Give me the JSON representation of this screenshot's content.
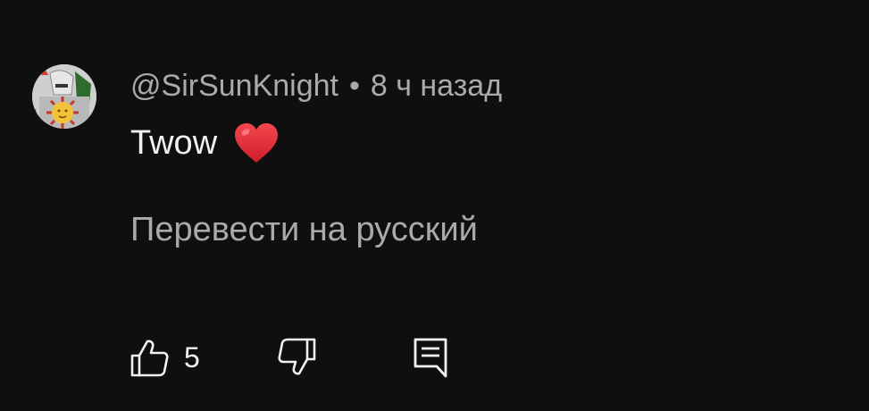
{
  "comment": {
    "author": "@SirSunKnight",
    "separator": "•",
    "time": "8 ч назад",
    "text": "Twow",
    "emoji": "heart-emoji",
    "translate_label": "Перевести на русский"
  },
  "actions": {
    "like_count": "5",
    "like_icon": "thumbs-up-icon",
    "dislike_icon": "thumbs-down-icon",
    "reply_icon": "comment-reply-icon"
  },
  "colors": {
    "background": "#0f0f0f",
    "primary_text": "#f1f1f1",
    "secondary_text": "#aaaaaa",
    "heart": "#e0242d"
  }
}
